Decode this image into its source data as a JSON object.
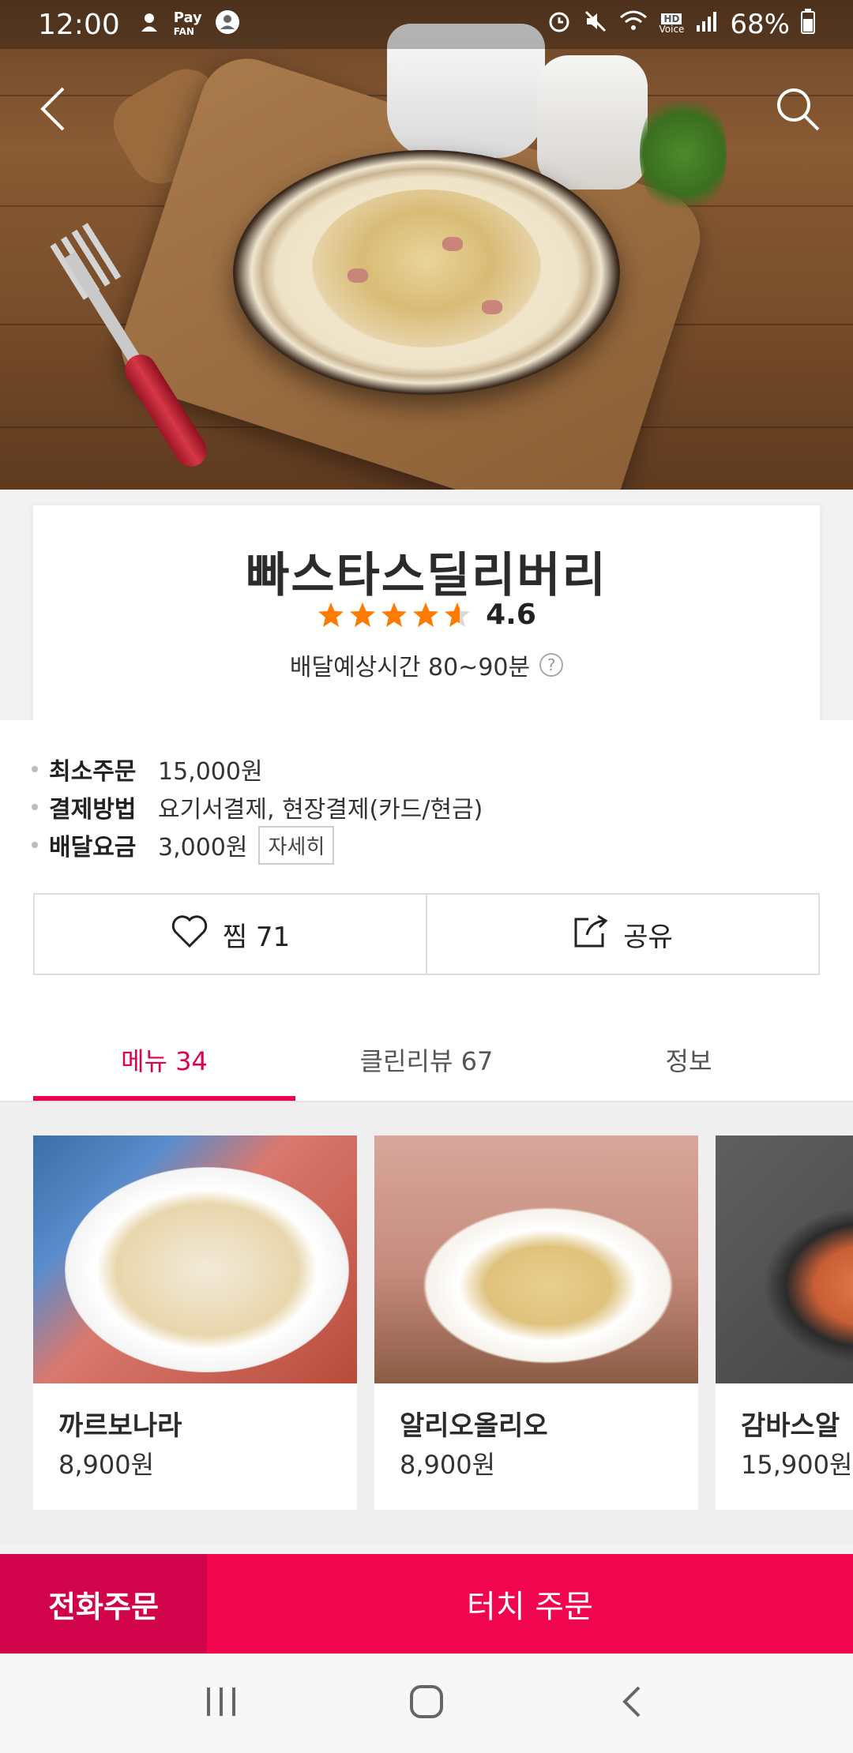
{
  "status_bar": {
    "time": "12:00",
    "pay_label": "Pay",
    "fan_label": "FAN",
    "hd_label": "HD",
    "voice_label": "Voice",
    "battery": "68%"
  },
  "store": {
    "name": "빠스타스딜리버리",
    "rating": "4.6",
    "rating_value": 4.6,
    "delivery_time": "배달예상시간 80~90분",
    "help_glyph": "?"
  },
  "info": [
    {
      "key": "최소주문",
      "value": "15,000원"
    },
    {
      "key": "결제방법",
      "value": "요기서결제, 현장결제(카드/현금)"
    },
    {
      "key": "배달요금",
      "value": "3,000원"
    }
  ],
  "detail_button": "자세히",
  "actions": {
    "like": "찜 71",
    "share": "공유"
  },
  "tabs": [
    {
      "label": "메뉴 34",
      "active": true
    },
    {
      "label": "클린리뷰 67",
      "active": false
    },
    {
      "label": "정보",
      "active": false
    }
  ],
  "menu_items": [
    {
      "name": "까르보나라",
      "price": "8,900원"
    },
    {
      "name": "알리오올리오",
      "price": "8,900원"
    },
    {
      "name": "감바스알",
      "price": "15,900원"
    }
  ],
  "order": {
    "phone": "전화주문",
    "touch": "터치 주문"
  },
  "colors": {
    "accent": "#f2054f",
    "accent_dark": "#d1044b",
    "star": "#ff7a00"
  },
  "icons": [
    "back-icon",
    "search-icon",
    "star-icon",
    "heart-icon",
    "share-icon",
    "help-icon",
    "recent-apps-icon",
    "home-icon",
    "nav-back-icon"
  ]
}
